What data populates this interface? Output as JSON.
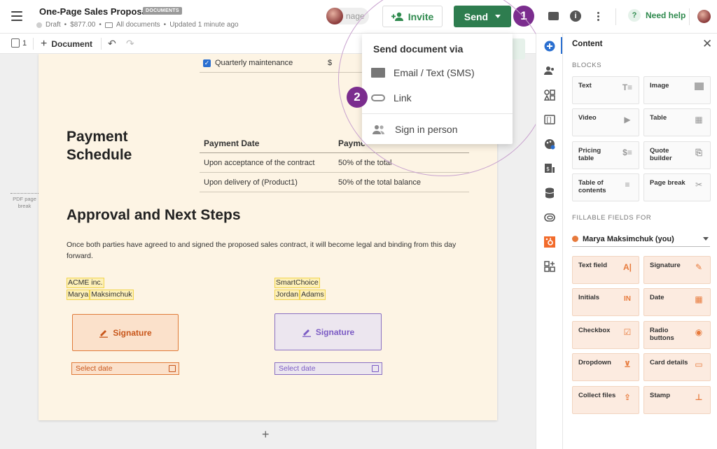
{
  "header": {
    "title": "One-Page Sales Proposal",
    "badge": "DOCUMENTS",
    "status": "Draft",
    "amount": "$877.00",
    "folder": "All documents",
    "updated": "Updated 1 minute ago",
    "manage_label": "nage",
    "invite_label": "Invite",
    "send_label": "Send",
    "help_label": "Need help",
    "step1": "1",
    "step2": "2"
  },
  "toolbar": {
    "page_count": "1",
    "add_document": "Document"
  },
  "send_menu": {
    "title": "Send document via",
    "items": [
      "Email / Text (SMS)",
      "Link",
      "Sign in person"
    ]
  },
  "document": {
    "maintenance_item": "Quarterly maintenance",
    "maintenance_price": "$",
    "payment_heading": "Payment Schedule",
    "payment_table": {
      "headers": [
        "Payment Date",
        "Payme"
      ],
      "rows": [
        [
          "Upon acceptance of the contract",
          "50% of the total"
        ],
        [
          "Upon delivery of (Product1)",
          "50% of the total balance"
        ]
      ]
    },
    "approval_heading": "Approval and Next Steps",
    "approval_text": "Once both parties have agreed to and signed the proposed sales contract, it will become legal and binding from this day forward.",
    "party1": {
      "company": "ACME inc.",
      "first": "Marya",
      "last": "Maksimchuk"
    },
    "party2": {
      "company": "SmartChoice",
      "first": "Jordan",
      "last": "Adams"
    },
    "signature_label": "Signature",
    "date_placeholder": "Select date",
    "pdf_break": "PDF page break"
  },
  "panel": {
    "title": "Content",
    "blocks_label": "BLOCKS",
    "blocks": [
      {
        "label": "Text",
        "icon": "text-icon"
      },
      {
        "label": "Image",
        "icon": "image-icon"
      },
      {
        "label": "Video",
        "icon": "video-icon"
      },
      {
        "label": "Table",
        "icon": "table-icon"
      },
      {
        "label": "Pricing table",
        "icon": "pricing-table-icon"
      },
      {
        "label": "Quote builder",
        "icon": "quote-builder-icon"
      },
      {
        "label": "Table of contents",
        "icon": "toc-icon"
      },
      {
        "label": "Page break",
        "icon": "scissors-icon"
      }
    ],
    "fillable_label": "FILLABLE FIELDS FOR",
    "recipient": "Marya Maksimchuk (you)",
    "fields": [
      {
        "label": "Text field",
        "icon": "text-field-icon"
      },
      {
        "label": "Signature",
        "icon": "signature-icon"
      },
      {
        "label": "Initials",
        "icon": "initials-icon"
      },
      {
        "label": "Date",
        "icon": "calendar-icon"
      },
      {
        "label": "Checkbox",
        "icon": "checkbox-icon"
      },
      {
        "label": "Radio buttons",
        "icon": "radio-icon"
      },
      {
        "label": "Dropdown",
        "icon": "dropdown-icon"
      },
      {
        "label": "Card details",
        "icon": "card-icon"
      },
      {
        "label": "Collect files",
        "icon": "upload-icon"
      },
      {
        "label": "Stamp",
        "icon": "stamp-icon"
      }
    ]
  },
  "colors": {
    "brand_green": "#2e7d4f",
    "step_purple": "#7b2d8e",
    "field_orange": "#e77a3c",
    "signer2_purple": "#7b5bc4",
    "page_bg": "#fdf4e4"
  }
}
